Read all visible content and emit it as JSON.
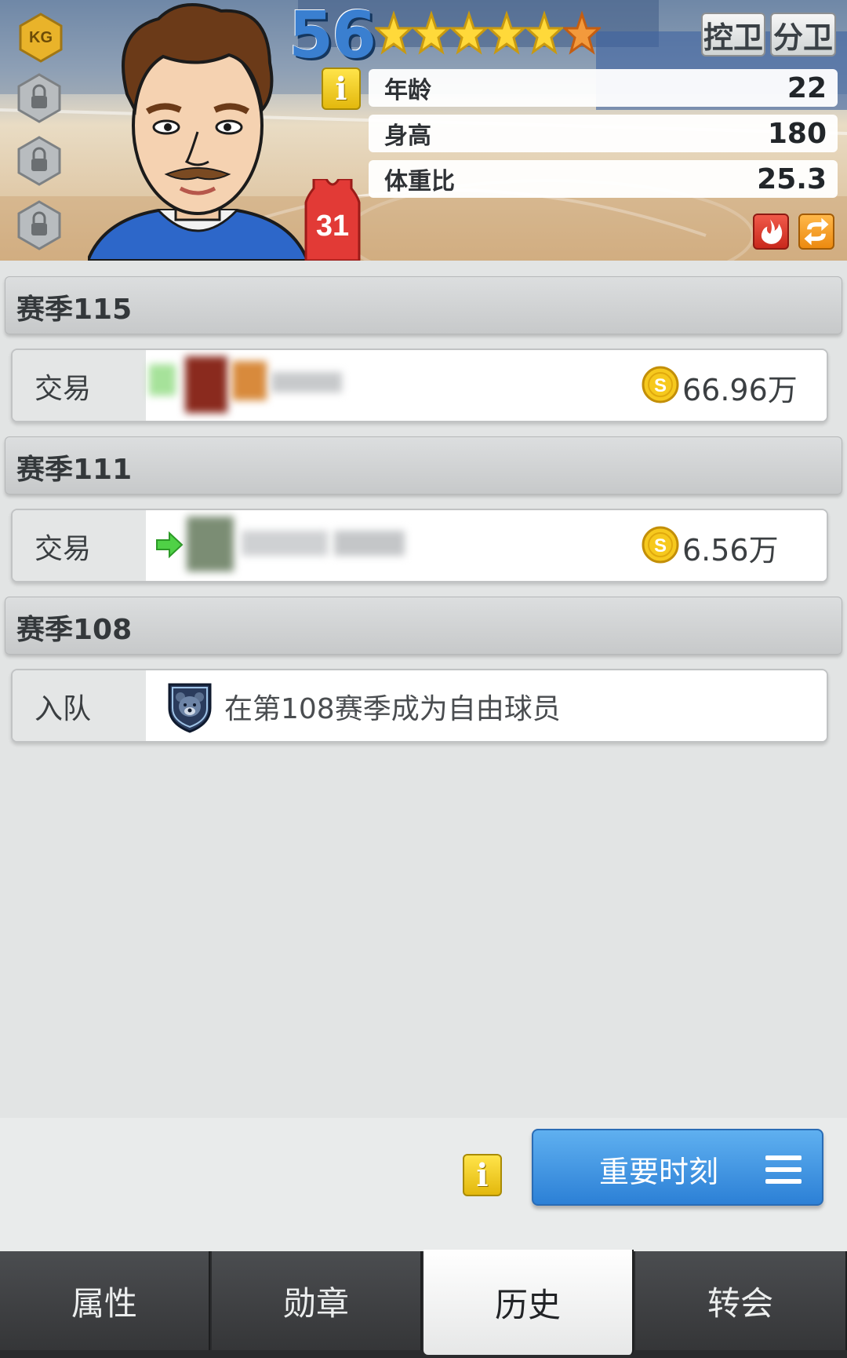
{
  "header": {
    "overall_rating": "56",
    "stars": 6,
    "badge_text": "KG",
    "jersey_number": "31",
    "positions": [
      "控卫",
      "分卫"
    ],
    "stats": [
      {
        "label": "年龄",
        "value": "22"
      },
      {
        "label": "身高",
        "value": "180"
      },
      {
        "label": "体重比",
        "value": "25.3"
      }
    ]
  },
  "history": [
    {
      "season": "赛季115",
      "type": "交易",
      "amount": "66.96万"
    },
    {
      "season": "赛季111",
      "type": "交易",
      "amount": "6.56万"
    },
    {
      "season": "赛季108",
      "type": "入队",
      "text": "在第108赛季成为自由球员"
    }
  ],
  "actions": {
    "moments_label": "重要时刻"
  },
  "tabs": [
    "属性",
    "勋章",
    "历史",
    "转会"
  ],
  "active_tab": "历史",
  "colors": {
    "accent_blue": "#2c80d6",
    "coin_gold": "#f3c21a",
    "rating_blue": "#3a7fd0"
  }
}
